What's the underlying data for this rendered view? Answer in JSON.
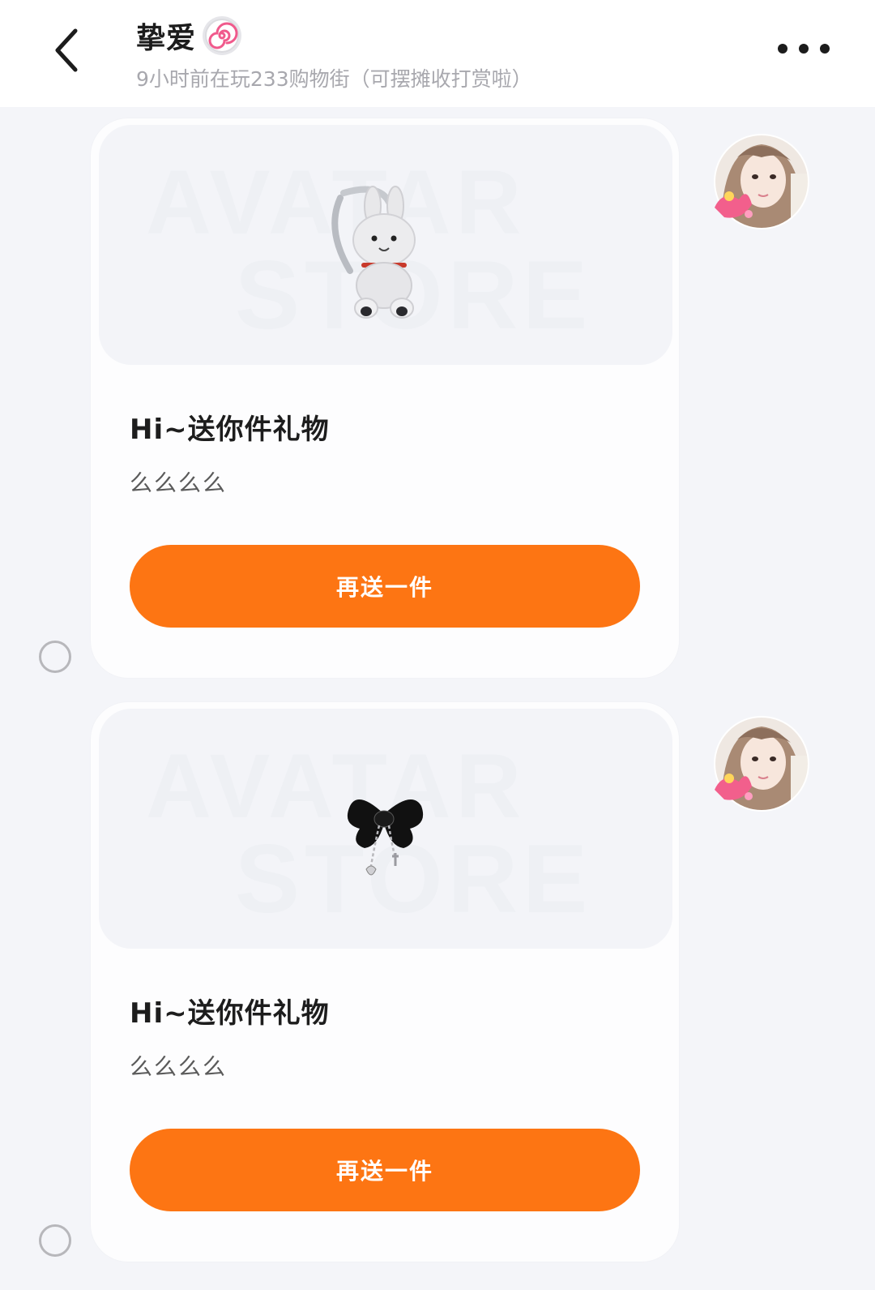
{
  "header": {
    "title": "挚爱",
    "subtitle": "9小时前在玩233购物街（可摆摊收打赏啦）",
    "back_icon": "chevron-left-icon",
    "badge_icon": "swirl-badge-icon",
    "more_icon": "more-horizontal-icon"
  },
  "messages": [
    {
      "card_title": "Hi~送你件礼物",
      "message": "么么么么",
      "button_label": "再送一件",
      "watermark_line1": "AVATAR",
      "watermark_line2": "STORE",
      "item_icon": "bunny-backpack-icon"
    },
    {
      "card_title": "Hi~送你件礼物",
      "message": "么么么么",
      "button_label": "再送一件",
      "watermark_line1": "AVATAR",
      "watermark_line2": "STORE",
      "item_icon": "bow-hairclip-icon"
    }
  ],
  "colors": {
    "accent": "#fd7513",
    "background": "#f4f5f9",
    "card": "#fdfdfe"
  }
}
